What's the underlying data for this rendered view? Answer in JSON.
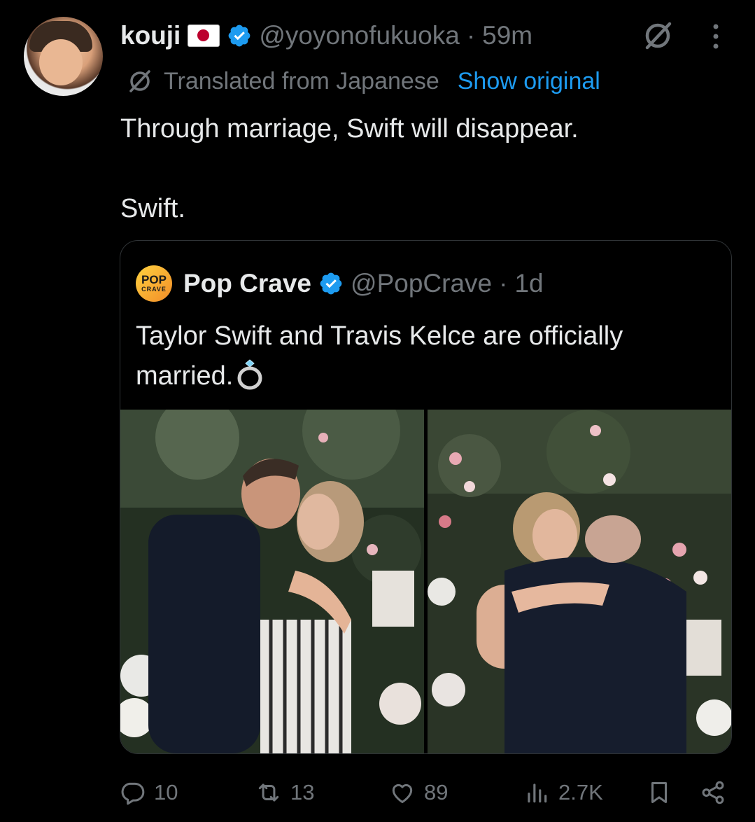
{
  "tweet": {
    "author_name": "kouji",
    "author_handle": "@yoyonofukuoka",
    "separator": "·",
    "time": "59m",
    "translated_label": "Translated from Japanese",
    "show_original_label": "Show original",
    "text": "Through marriage, Swift will disappear.\n\nSwift."
  },
  "quote": {
    "logo_text_top": "POP",
    "logo_text_bottom": "CRAVE",
    "author_name": "Pop Crave",
    "author_handle": "@PopCrave",
    "separator": "·",
    "time": "1d",
    "text": "Taylor Swift and Travis Kelce are officially married."
  },
  "actions": {
    "replies": "10",
    "reposts": "13",
    "likes": "89",
    "views": "2.7K"
  },
  "colors": {
    "background": "#000000",
    "text": "#e7e9ea",
    "muted": "#71767b",
    "link": "#1d9bf0",
    "verified": "#1d9bf0",
    "border": "#2f3336"
  },
  "icons": [
    "grok-icon",
    "more-icon",
    "translate-icon",
    "verified-icon",
    "ring-icon",
    "reply-icon",
    "repost-icon",
    "like-icon",
    "views-icon",
    "bookmark-icon",
    "share-icon"
  ]
}
